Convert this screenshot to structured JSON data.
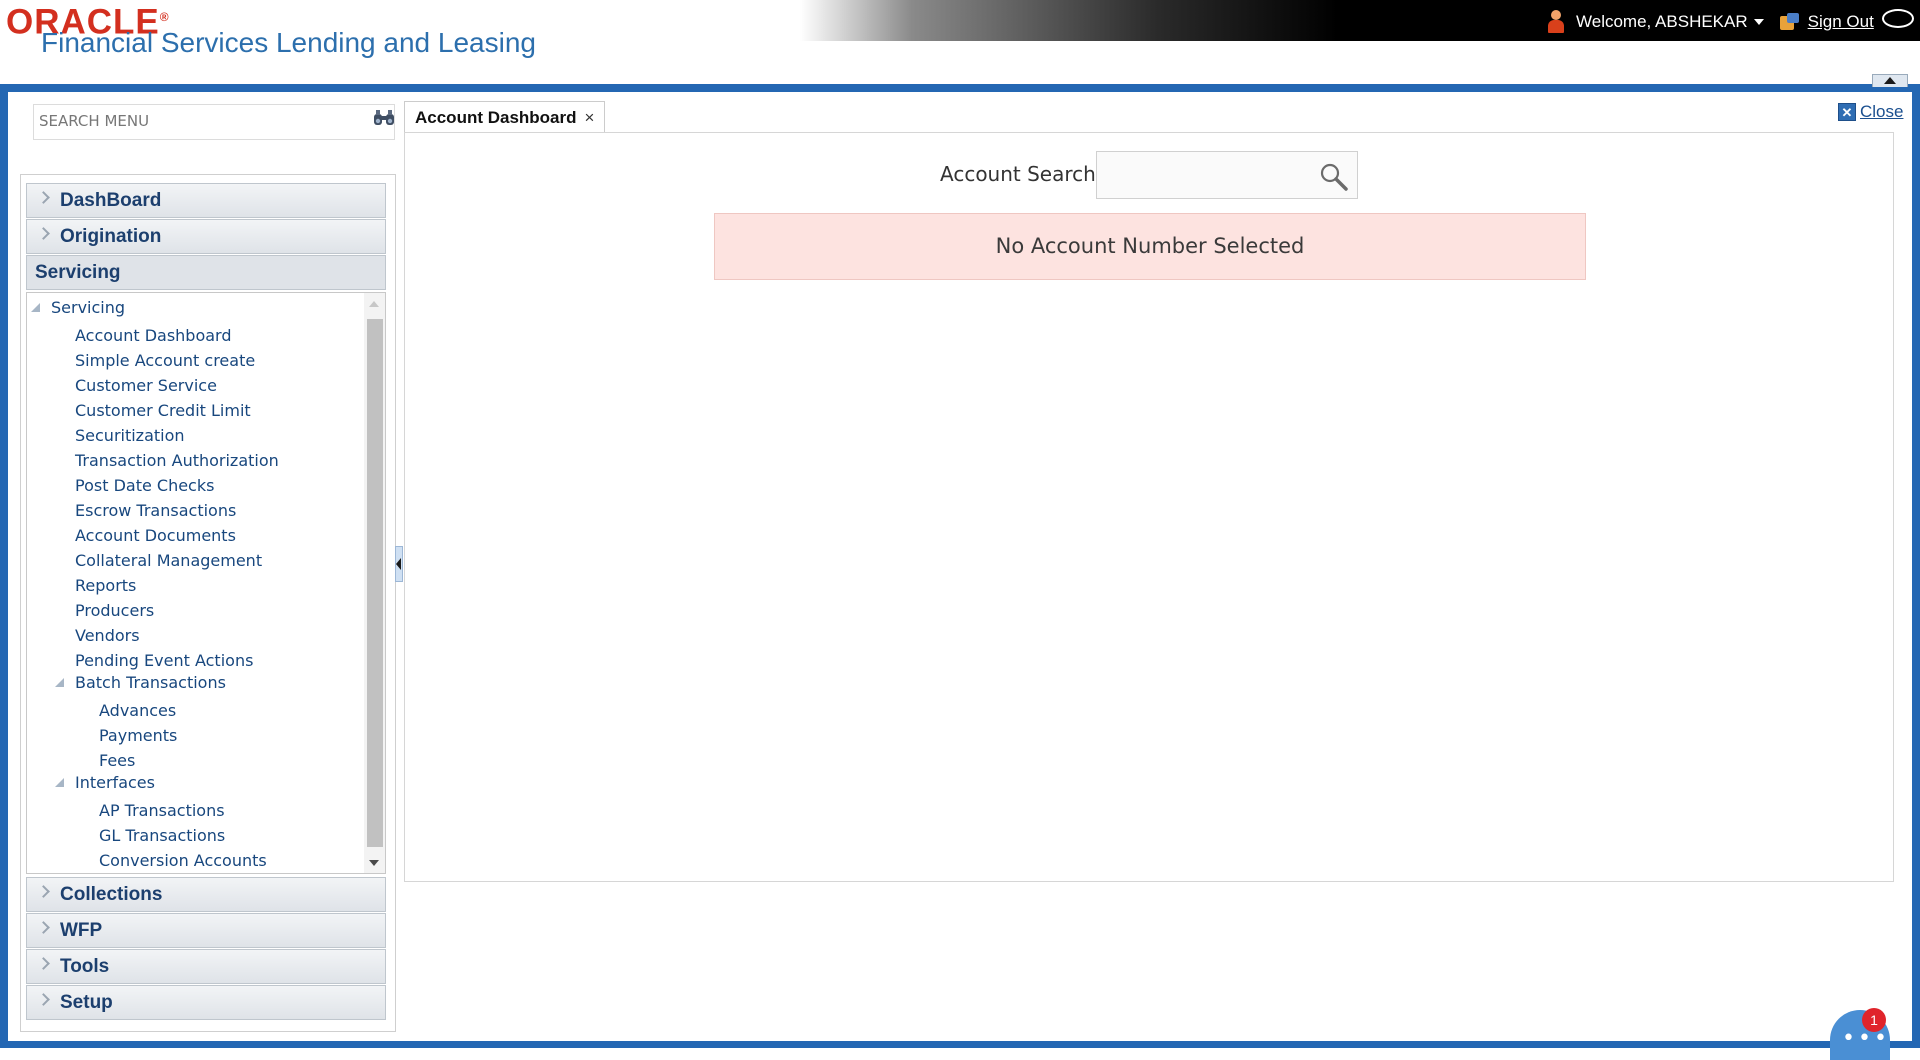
{
  "header": {
    "brand": "ORACLE",
    "brand_trademark": "®",
    "product": "Financial Services Lending and Leasing",
    "welcome": "Welcome, ABSHEKAR",
    "sign_out": "Sign Out"
  },
  "search_menu": {
    "placeholder": "SEARCH MENU"
  },
  "menu": {
    "dashboard": "DashBoard",
    "origination": "Origination",
    "servicing": "Servicing",
    "collections": "Collections",
    "wfp": "WFP",
    "tools": "Tools",
    "setup": "Setup"
  },
  "tree": {
    "root": "Servicing",
    "items": [
      "Account Dashboard",
      "Simple Account create",
      "Customer Service",
      "Customer Credit Limit",
      "Securitization",
      "Transaction Authorization",
      "Post Date Checks",
      "Escrow Transactions",
      "Account Documents",
      "Collateral Management",
      "Reports",
      "Producers",
      "Vendors",
      "Pending Event Actions"
    ],
    "batch": {
      "label": "Batch Transactions",
      "children": [
        "Advances",
        "Payments",
        "Fees"
      ]
    },
    "interfaces": {
      "label": "Interfaces",
      "children": [
        "AP Transactions",
        "GL Transactions",
        "Conversion Accounts"
      ]
    }
  },
  "tab": {
    "label": "Account Dashboard",
    "close_symbol": "×"
  },
  "close_label": "Close",
  "account_search": {
    "label": "Account Search",
    "value": ""
  },
  "alert": "No Account Number Selected",
  "chat": {
    "badge": "1"
  },
  "colors": {
    "frame": "#2467b3",
    "brand_red": "#d32f1f",
    "product_blue": "#2c6fad",
    "alert_bg": "#fde3e0"
  }
}
